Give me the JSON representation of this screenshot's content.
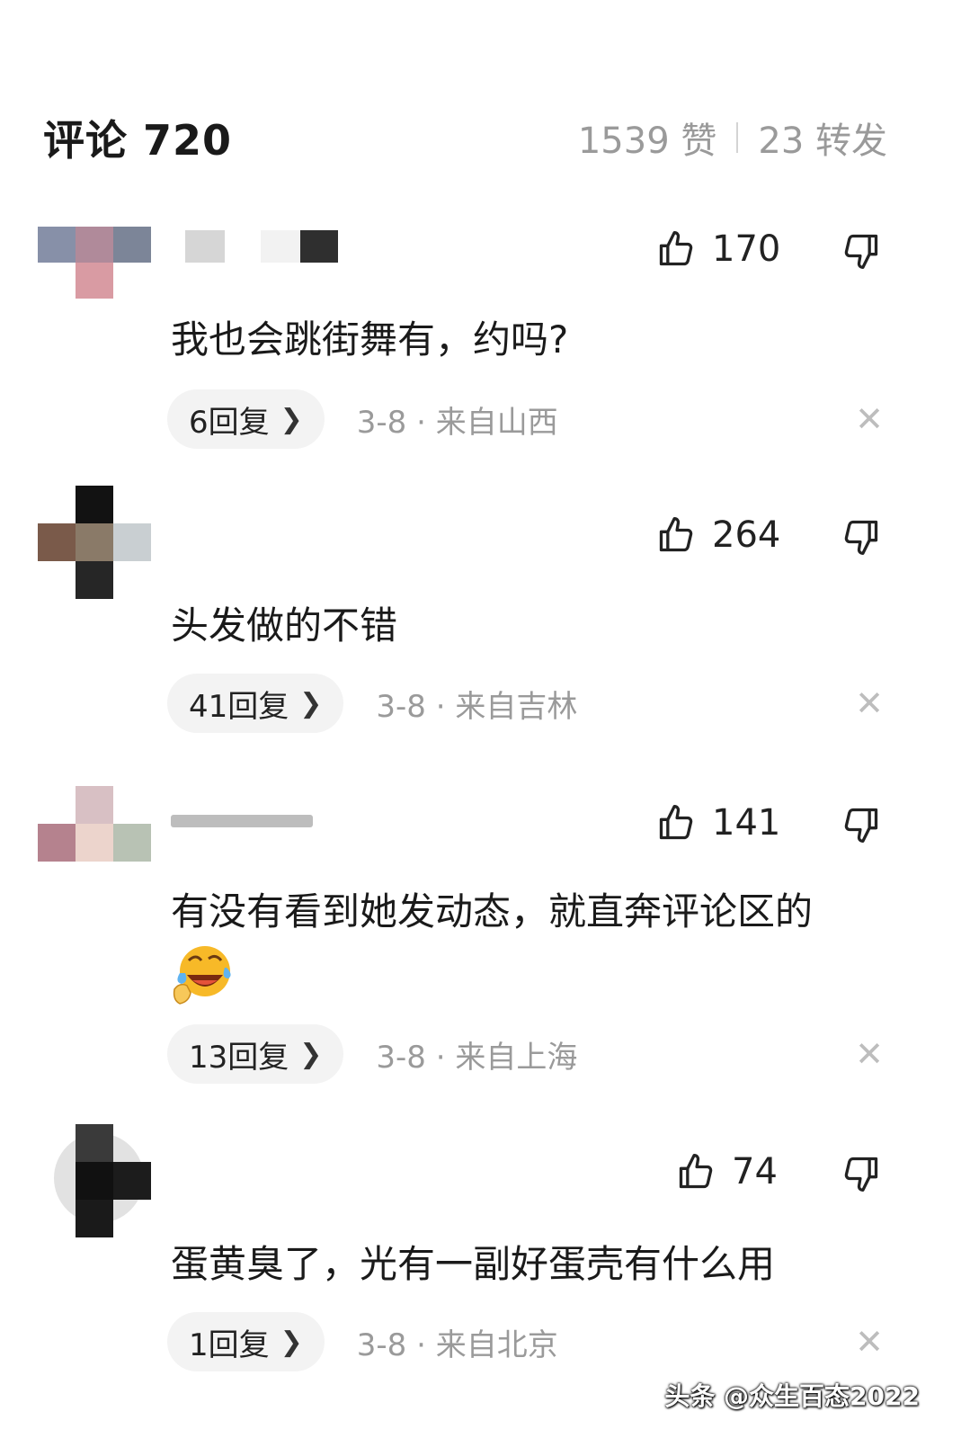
{
  "header": {
    "title": "评论 720",
    "likes": "1539 赞",
    "shares": "23 转发"
  },
  "comments": [
    {
      "like_count": "170",
      "text": "我也会跳街舞有，约吗?",
      "reply_label": "6回复",
      "meta": "3-8 · 来自山西"
    },
    {
      "like_count": "264",
      "text": "头发做的不错",
      "reply_label": "41回复",
      "meta": "3-8 · 来自吉林"
    },
    {
      "like_count": "141",
      "text": "有没有看到她发动态，就直奔评论区的",
      "reply_label": "13回复",
      "meta": "3-8 · 来自上海"
    },
    {
      "like_count": "74",
      "text": "蛋黄臭了，光有一副好蛋壳有什么用",
      "reply_label": "1回复",
      "meta": "3-8 · 来自北京"
    }
  ],
  "icons": {
    "like": "thumbs-up-icon",
    "dislike": "thumbs-down-icon",
    "close": "close-icon",
    "chevron": "chevron-right-icon",
    "emoji": "laughing-crying-emoji"
  },
  "watermark": "头条 @众生百态2022"
}
